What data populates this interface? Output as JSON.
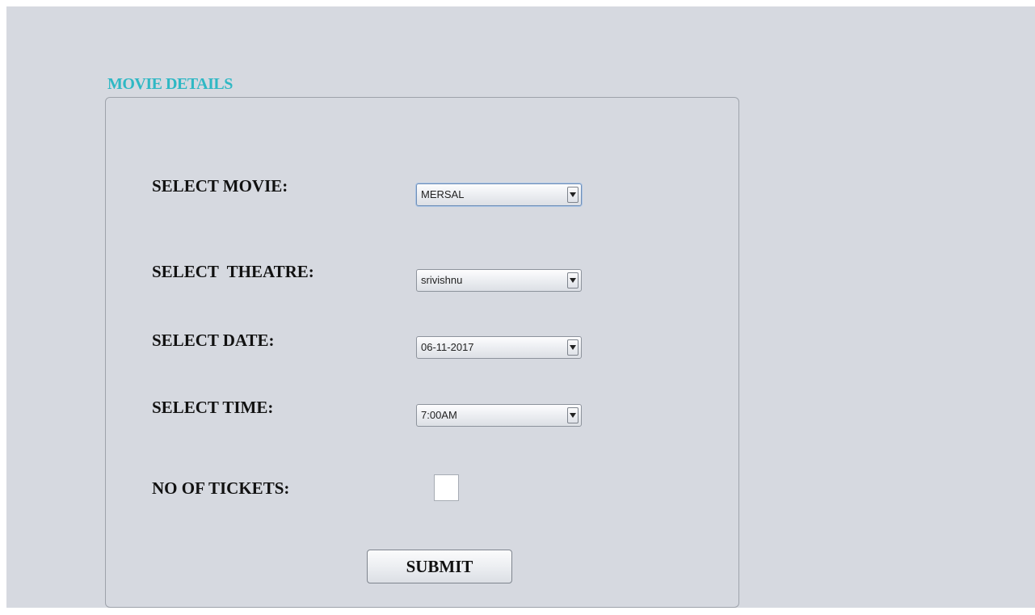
{
  "panel": {
    "title": "MOVIE DETAILS"
  },
  "form": {
    "movie": {
      "label": "SELECT MOVIE:",
      "value": "MERSAL"
    },
    "theatre": {
      "label": "SELECT  THEATRE:",
      "value": "srivishnu"
    },
    "date": {
      "label": "SELECT DATE:",
      "value": "06-11-2017"
    },
    "time": {
      "label": "SELECT TIME:",
      "value": "7:00AM"
    },
    "tickets": {
      "label": "NO OF TICKETS:",
      "value": ""
    },
    "submit_label": "SUBMIT"
  },
  "icons": {
    "dropdown": "chevron-down-icon"
  },
  "colors": {
    "background": "#d6d9e0",
    "title_accent": "#2fb8c4",
    "focus_border": "#6f8fb8"
  }
}
